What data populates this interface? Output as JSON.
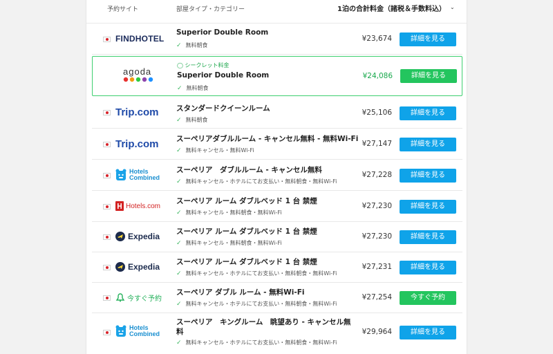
{
  "header": {
    "site_label": "予約サイト",
    "room_label": "部屋タイプ・カテゴリー",
    "price_label": "1泊の合計料金（諸税＆手数料込）"
  },
  "secret_label": "シークレット料金",
  "rows": [
    {
      "logo_text": "FINDHOTEL",
      "room": "Superior Double Room",
      "amenity": "無料朝食",
      "price": "¥23,674",
      "button": "詳細を見る"
    },
    {
      "logo_text": "agoda",
      "room": "Superior Double Room",
      "amenity": "無料朝食",
      "price": "¥24,086",
      "button": "詳細を見る"
    },
    {
      "logo_text": "Trip.com",
      "room": "スタンダードクイーンルーム",
      "amenity": "無料朝食",
      "price": "¥25,106",
      "button": "詳細を見る"
    },
    {
      "logo_text": "Trip.com",
      "room": "スーペリアダブルルーム - キャンセル無料 - 無料Wi-Fi",
      "amenity": "無料キャンセル・無料Wi-Fi",
      "price": "¥27,147",
      "button": "詳細を見る"
    },
    {
      "logo_text": "Hotels Combined",
      "room": "スーペリア　ダブルルーム - キャンセル無料",
      "amenity": "無料キャンセル・ホテルにてお支払い・無料朝食・無料Wi-Fi",
      "price": "¥27,228",
      "button": "詳細を見る"
    },
    {
      "logo_text": "Hotels.com",
      "room": "スーペリア ルーム ダブルベッド 1 台 禁煙",
      "amenity": "無料キャンセル・無料朝食・無料Wi-Fi",
      "price": "¥27,230",
      "button": "詳細を見る"
    },
    {
      "logo_text": "Expedia",
      "room": "スーペリア ルーム ダブルベッド 1 台 禁煙",
      "amenity": "無料キャンセル・無料朝食・無料Wi-Fi",
      "price": "¥27,230",
      "button": "詳細を見る"
    },
    {
      "logo_text": "Expedia",
      "room": "スーペリア ルーム ダブルベッド 1 台 禁煙",
      "amenity": "無料キャンセル・ホテルにてお支払い・無料朝食・無料Wi-Fi",
      "price": "¥27,231",
      "button": "詳細を見る"
    },
    {
      "logo_text": "今すぐ予約",
      "room": "スーペリア ダブル ルーム - 無料Wi-Fi",
      "amenity": "無料キャンセル・ホテルにてお支払い・無料朝食・無料Wi-Fi",
      "price": "¥27,254",
      "button": "今すぐ予約"
    },
    {
      "logo_text": "Hotels Combined",
      "room": "スーペリア　キングルーム　眺望あり - キャンセル無",
      "room_line2": "料",
      "amenity": "無料キャンセル・ホテルにてお支払い・無料朝食・無料Wi-Fi",
      "price": "¥29,964",
      "button": "詳細を見る"
    }
  ],
  "colors": {
    "button_blue": "#0fa3e9",
    "button_green": "#23c55e",
    "highlight_border": "#3ccf6e",
    "price_green": "#17a84b",
    "agoda_dots": [
      "#e8312f",
      "#f39c12",
      "#2ecc40",
      "#8e44ad",
      "#1e90ff"
    ]
  },
  "icons": {
    "flag": "japan-flag-icon",
    "check": "check-icon",
    "lock": "lock-icon",
    "chevron": "chevron-down-icon"
  }
}
